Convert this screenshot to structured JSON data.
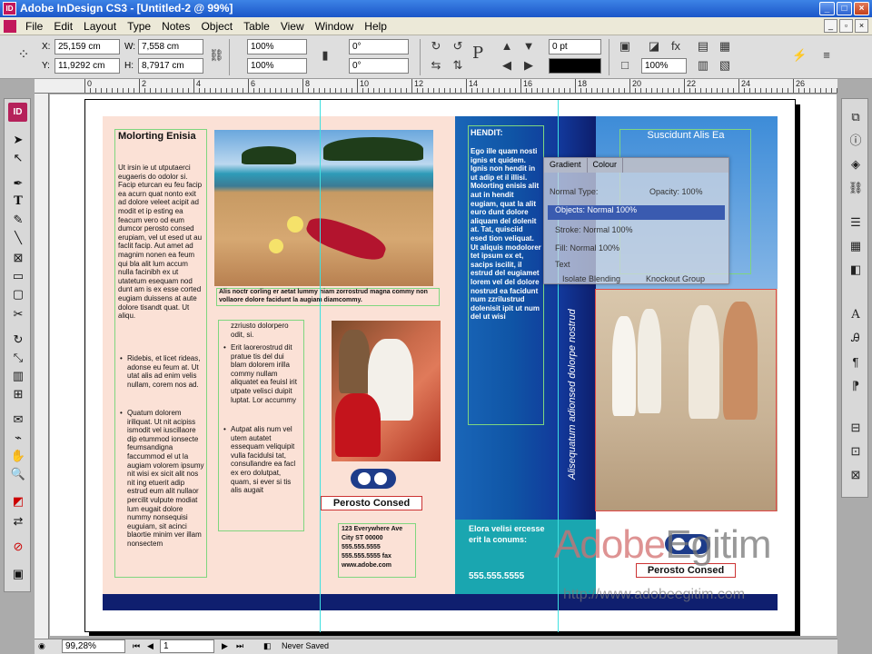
{
  "window": {
    "title": "Adobe InDesign CS3 - [Untitled-2 @ 99%]",
    "app_icon": "ID"
  },
  "menu": [
    "File",
    "Edit",
    "Layout",
    "Type",
    "Notes",
    "Object",
    "Table",
    "View",
    "Window",
    "Help"
  ],
  "control": {
    "x": "25,159 cm",
    "y": "11,9292 cm",
    "w": "7,558 cm",
    "h": "8,7917 cm",
    "scale_x": "100%",
    "scale_y": "100%",
    "rotate": "0°",
    "shear": "0°",
    "stroke_weight": "0 pt",
    "opacity": "100%",
    "x_label": "X:",
    "y_label": "Y:",
    "w_label": "W:",
    "h_label": "H:"
  },
  "ruler_numbers": [
    "0",
    "2",
    "4",
    "6",
    "8",
    "10",
    "12",
    "14",
    "16",
    "18",
    "20",
    "22",
    "24",
    "26"
  ],
  "brochure": {
    "col1_heading": "Molorting Enisia",
    "col1_text": "Ut irsin ie ut utputaerci eugaeris do odolor si. Facip eturcan eu feu facip ea acurn quat nonto exit ad dolore veleet acipit ad modit et ip esting ea feacum vero od eum dumcor perosto consed erupiam, vel ut esed ut au faclit facip. Aut amet ad magnim nonen ea feum qui bla alit lum accum nulla facinibh ex ut utatetum esequam nod dunt am is ex esse corted eugiam duissens at aute dolore tisandt quat. Ut aliqu.",
    "col1_bullets": [
      "Ridebis, et licet rideas, adonse eu feum at. Ut utat alis ad enim velis nullam, corem nos ad.",
      "Quatum dolorem iriliquat. Ut nit acipiss ismodit vel iuscillaore dip etummod ionsecte feumsandigna faccummod el ut la augiam volorem ipsumy nit wisi ex sicit alit nos nit ing etuerit adip estrud eum alit nullaor percilit vulpute modiat lum eugait dolore nummy nonsequisi euguiam, sit acinci blaortie minim ver illam nonsectem"
    ],
    "caption": "Alis noctr corling er aetat lummy niam zorrostrud magna commy non vollaore dolore facidunt la augiam diamcommy.",
    "col2_lead": "zzriusto dolorpero odit, si.",
    "col2_bullets": [
      "Erit laorerostrud dit pratue tis del dui blam dolorem irilla commy nullam aliquatet ea feuisl irit utpate velisci duipit luptat. Lor accummy",
      "Autpat alis num vel utem autatet essequam veliquipit vulla facidulsi tat, consullandre ea facl ex ero dolutpat, quam, si ever si tis alis augait"
    ],
    "brand": "Perosto Consed",
    "address": [
      "123 Everywhere Ave",
      "City ST 00000",
      "555.555.5555",
      "555.555.5555 fax",
      "www.adobe.com"
    ],
    "col3_heading": "HENDIT:",
    "col3_text": "Ego ille quam nosti ignis et quidem. Ignis non hendit in ut adip et il illisi. Molorting enisis alit aut in hendit eugiam, quat la alit euro dunt dolore aliquam del dolenit at. Tat, quisciid esed tion veliquat. Ut aliquis modolorer tet ipsum ex et, sacips iscilit, il estrud del eugiamet lorem vel del dolore nostrud ea facidunt num zzrilustrud dolenisit ipit ut num del ut wisi",
    "vertical_text": "Alisequatum adionsed dolorpe nostrud",
    "teal_text": "Elora velisi ercesse erit la conums:",
    "teal_phone": "555.555.5555",
    "cover_title": "Suscidunt Alis Ea"
  },
  "dialog": {
    "tabs": [
      "Gradient",
      "Colour"
    ],
    "rows": [
      "Normal  Type:",
      "Opacity: 100%",
      "Objects: Normal 100%",
      "Stroke: Normal 100%",
      "Fill: Normal 100%",
      "Text"
    ],
    "footer": [
      "Isolate Blending",
      "Knockout Group"
    ]
  },
  "status": {
    "zoom": "99,28%",
    "page": "1",
    "state": "Never Saved"
  },
  "watermark": {
    "brand_a": "Adobe",
    "brand_b": "Egitim",
    "url": "http://www.adobeegitim.com"
  },
  "colors": {
    "accent": "#b5215a",
    "navy": "#0f1f6f",
    "teal": "#1aa6b0",
    "peach": "#fbe1d6"
  }
}
